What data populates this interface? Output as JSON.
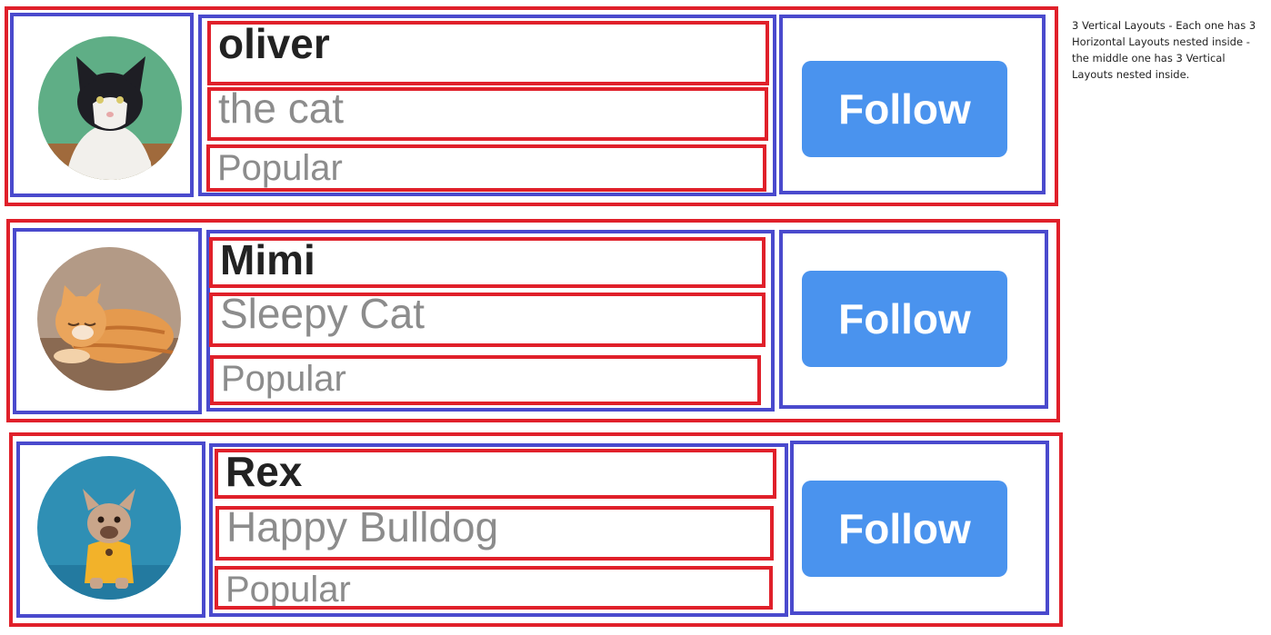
{
  "annotation": "3 Vertical Layouts - Each one has 3 Horizontal Layouts nested inside - the middle one has 3 Vertical Layouts nested inside.",
  "colors": {
    "outer_border": "#e0202a",
    "inner_border": "#4a4acd",
    "name_text": "#222222",
    "secondary_text": "#8c8c8c",
    "button_bg": "#4a93ee",
    "button_text": "#ffffff"
  },
  "profiles": [
    {
      "name": "oliver",
      "subtitle": "the cat",
      "tag": "Popular",
      "button_label": "Follow",
      "avatar_icon": "cat-avatar-icon"
    },
    {
      "name": "Mimi",
      "subtitle": "Sleepy Cat",
      "tag": "Popular",
      "button_label": "Follow",
      "avatar_icon": "sleeping-cat-avatar-icon"
    },
    {
      "name": "Rex",
      "subtitle": "Happy Bulldog",
      "tag": "Popular",
      "button_label": "Follow",
      "avatar_icon": "bulldog-avatar-icon"
    }
  ]
}
